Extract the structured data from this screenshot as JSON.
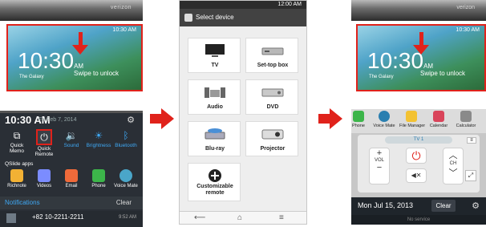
{
  "colors": {
    "accent_red": "#e0221b",
    "qs_blue": "#3fa9f5",
    "panel_dark": "#2a2f36"
  },
  "left_phone": {
    "brand": "verizon",
    "status": "10:30 AM",
    "lock_time": "10:30",
    "lock_ampm": "AM",
    "weather": "The Galaxy",
    "swipe_text": "Swipe to unlock",
    "panel_time": "10:30 AM",
    "panel_date": "Fri Feb 7, 2014",
    "quick_settings": [
      {
        "label": "Quick\nMemo",
        "icon": "quick-memo-icon"
      },
      {
        "label": "Quick\nRemote",
        "icon": "power-icon"
      },
      {
        "label": "Sound",
        "icon": "sound-icon"
      },
      {
        "label": "Brightness",
        "icon": "brightness-icon"
      },
      {
        "label": "Bluetooth",
        "icon": "bluetooth-icon"
      }
    ],
    "qslide_label": "QSlide apps",
    "apps": [
      "Richnote",
      "Videos",
      "Email",
      "Phone",
      "Voice Mate"
    ],
    "notifications_label": "Notifications",
    "clear_label": "Clear",
    "call_number": "+82 10-2211-2211",
    "call_time": "9:52 AM"
  },
  "middle_phone": {
    "status_time": "12:00 AM",
    "title": "Select device",
    "devices": [
      "TV",
      "Set-top box",
      "Audio",
      "DVD",
      "Blu-ray",
      "Projector",
      "Customizable\nremote"
    ]
  },
  "right_phone": {
    "brand": "verizon",
    "status": "10:30 AM",
    "lock_time": "10:30",
    "lock_ampm": "AM",
    "weather": "The Galaxy",
    "swipe_text": "Swipe to unlock",
    "apps": [
      "Phone",
      "Voice Mate",
      "File Manager",
      "Calendar",
      "Calculator"
    ],
    "tv_label": "TV 1",
    "vol_label": "VOL",
    "ch_label": "CH",
    "date": "Mon Jul 15, 2013",
    "clear_label": "Clear",
    "no_service": "No service"
  }
}
